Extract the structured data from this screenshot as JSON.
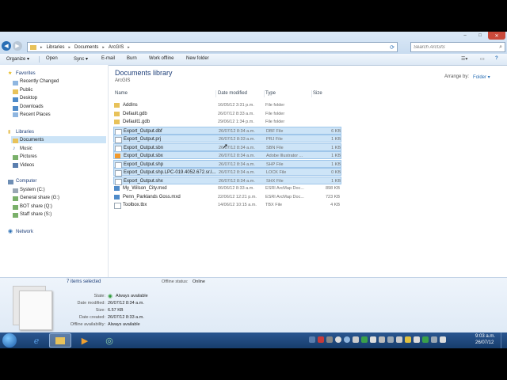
{
  "address": {
    "crumbs": [
      "Libraries",
      "Documents",
      "ArcGIS"
    ]
  },
  "search": {
    "placeholder": "Search ArcGIS"
  },
  "window_controls": {
    "minimize": "–",
    "maximize": "□",
    "close": "✕"
  },
  "toolbar": {
    "organize": "Organize ▾",
    "open": "Open",
    "sync": "Sync ▾",
    "email": "E-mail",
    "burn": "Burn",
    "work_offline": "Work offline",
    "new_folder": "New folder"
  },
  "nav": {
    "favorites": "Favorites",
    "favorites_items": [
      "Recently Changed",
      "Public",
      "Desktop",
      "Downloads",
      "Recent Places"
    ],
    "libraries": "Libraries",
    "libraries_items": [
      "Documents",
      "Music",
      "Pictures",
      "Videos"
    ],
    "computer": "Computer",
    "computer_items": [
      "System (C:)",
      "General share (G:)",
      "BOT share (Q:)",
      "Staff share (S:)"
    ],
    "network": "Network"
  },
  "main": {
    "title": "Documents library",
    "subtitle": "ArcGIS",
    "arrange_by_label": "Arrange by:",
    "arrange_by_value": "Folder ▾",
    "columns": {
      "name": "Name",
      "date": "Date modified",
      "type": "Type",
      "size": "Size"
    }
  },
  "files": [
    {
      "name": "AddIns",
      "date": "16/05/12 3:31 p.m.",
      "type": "File folder",
      "size": "",
      "icon": "folder-icon",
      "selected": false
    },
    {
      "name": "Default.gdb",
      "date": "26/07/12 8:33 a.m.",
      "type": "File folder",
      "size": "",
      "icon": "folder-icon",
      "selected": false
    },
    {
      "name": "Default1.gdb",
      "date": "29/06/12 1:34 p.m.",
      "type": "File folder",
      "size": "",
      "icon": "folder-icon",
      "selected": false
    },
    {
      "name": "Export_Output.dbf",
      "date": "26/07/12 8:34 a.m.",
      "type": "DBF File",
      "size": "6 KB",
      "icon": "file-icon",
      "selected": true
    },
    {
      "name": "Export_Output.prj",
      "date": "26/07/12 8:33 a.m.",
      "type": "PRJ File",
      "size": "1 KB",
      "icon": "file-icon",
      "selected": true
    },
    {
      "name": "Export_Output.sbn",
      "date": "26/07/12 8:34 a.m.",
      "type": "SBN File",
      "size": "1 KB",
      "icon": "file-icon",
      "selected": true
    },
    {
      "name": "Export_Output.sbx",
      "date": "26/07/12 8:34 a.m.",
      "type": "Adobe Illustrator ...",
      "size": "1 KB",
      "icon": "illustrator-file-icon",
      "selected": true
    },
    {
      "name": "Export_Output.shp",
      "date": "26/07/12 8:34 a.m.",
      "type": "SHP File",
      "size": "1 KB",
      "icon": "file-icon",
      "selected": true
    },
    {
      "name": "Export_Output.shp.LPC-019.4052.672.sr.l...",
      "date": "26/07/12 8:34 a.m.",
      "type": "LOCK File",
      "size": "0 KB",
      "icon": "file-icon",
      "selected": true
    },
    {
      "name": "Export_Output.shx",
      "date": "26/07/12 8:34 a.m.",
      "type": "SHX File",
      "size": "1 KB",
      "icon": "file-icon",
      "selected": true
    },
    {
      "name": "My_Wilson_City.mxd",
      "date": "06/06/12 8:33 a.m.",
      "type": "ESRI ArcMap Doc...",
      "size": "898 KB",
      "icon": "arcmap-doc-icon",
      "selected": false
    },
    {
      "name": "Penn_Parklands Goss.mxd",
      "date": "22/06/12 12:21 p.m.",
      "type": "ESRI ArcMap Doc...",
      "size": "723 KB",
      "icon": "arcmap-doc-icon",
      "selected": false
    },
    {
      "name": "Toolbox.tbx",
      "date": "14/06/12 10:15 a.m.",
      "type": "TBX File",
      "size": "4 KB",
      "icon": "file-icon",
      "selected": false
    }
  ],
  "details": {
    "selected_count": "7 items selected",
    "offline_status_label": "Offline status:",
    "offline_status_value": "Online",
    "state_label": "State:",
    "state_value": "Always available",
    "date_modified_label": "Date modified:",
    "date_modified_value": "26/07/12 8:34 a.m.",
    "size_label": "Size:",
    "size_value": "6.57 KB",
    "date_created_label": "Date created:",
    "date_created_value": "26/07/12 8:33 a.m.",
    "offline_avail_label": "Offline availability:",
    "offline_avail_value": "Always available"
  },
  "taskbar": {
    "time": "9:03 a.m.",
    "date": "26/07/12"
  },
  "colors": {
    "selection": "#cde4f7",
    "folder": "#e8c25a",
    "taskbar": "#1f4a80",
    "library_title": "#1e3f79"
  }
}
